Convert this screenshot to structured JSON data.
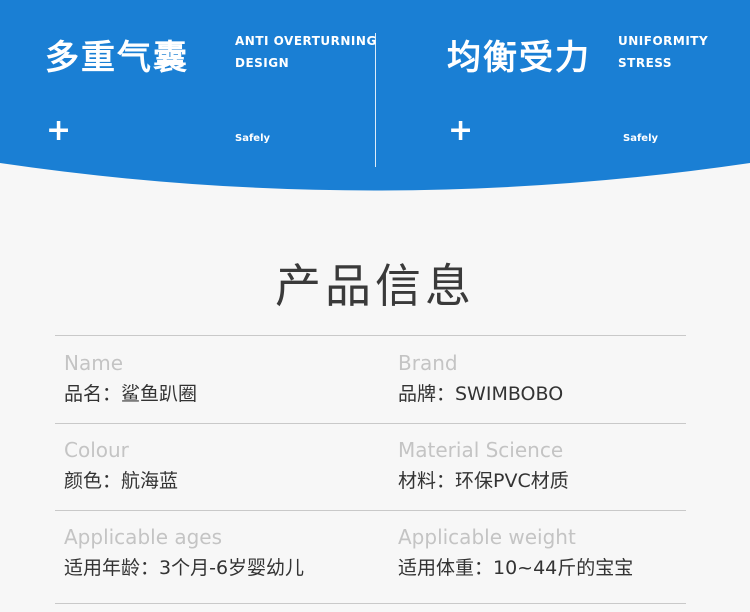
{
  "banner": {
    "color": "#1a7fd4",
    "left_feature": {
      "title": "多重气囊",
      "subtitle_line1": "ANTI OVERTURNING",
      "subtitle_line2": "DESIGN",
      "plus": "+",
      "note": "Safely"
    },
    "right_feature": {
      "title": "均衡受力",
      "subtitle_line1": "UNIFORMITY",
      "subtitle_line2": "STRESS",
      "plus": "+",
      "note": "Safely"
    }
  },
  "product_info": {
    "title": "产品信息",
    "rows": [
      {
        "left": {
          "label_en": "Name",
          "value": "品名：鲨鱼趴圈"
        },
        "right": {
          "label_en": "Brand",
          "value": "品牌：SWIMBOBO"
        }
      },
      {
        "left": {
          "label_en": "Colour",
          "value": "颜色：航海蓝"
        },
        "right": {
          "label_en": "Material Science",
          "value": "材料：环保PVC材质"
        }
      },
      {
        "left": {
          "label_en": "Applicable ages",
          "value": "适用年龄：3个月-6岁婴幼儿"
        },
        "right": {
          "label_en": "Applicable weight",
          "value": "适用体重：10~44斤的宝宝"
        }
      }
    ]
  }
}
